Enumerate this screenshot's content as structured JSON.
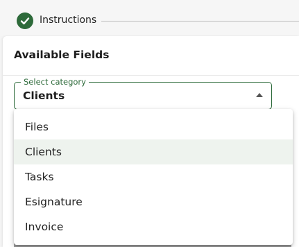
{
  "stepper": {
    "step_label": "Instructions",
    "accent": "#2d6a3a"
  },
  "panel": {
    "title": "Available Fields"
  },
  "category_select": {
    "legend": "Select category",
    "value": "Clients",
    "options": [
      {
        "label": "Files",
        "selected": false
      },
      {
        "label": "Clients",
        "selected": true
      },
      {
        "label": "Tasks",
        "selected": false
      },
      {
        "label": "Esignature",
        "selected": false
      },
      {
        "label": "Invoice",
        "selected": false
      }
    ]
  }
}
